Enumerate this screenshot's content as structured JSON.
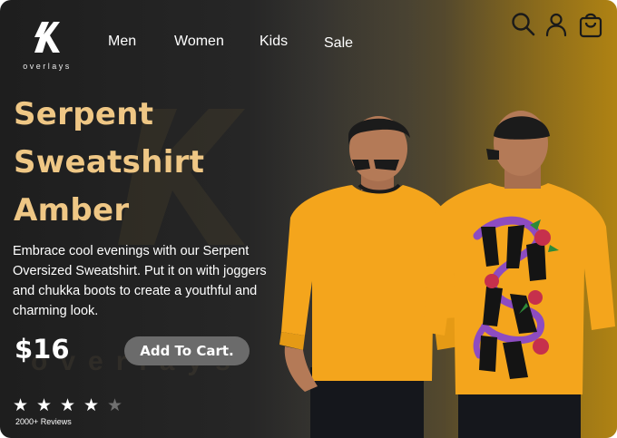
{
  "brand": {
    "name": "overlays",
    "icon": "overlays-logo-icon"
  },
  "nav": {
    "items": [
      {
        "label": "Men"
      },
      {
        "label": "Women"
      },
      {
        "label": "Kids"
      },
      {
        "label": "Sale"
      }
    ]
  },
  "header_icons": [
    "search-icon",
    "user-icon",
    "shopping-bag-icon"
  ],
  "product": {
    "title_lines": [
      "Serpent",
      "Sweatshirt",
      "Amber"
    ],
    "description": "Embrace cool evenings with our Serpent Oversized Sweatshirt. Put it on with joggers and chukka boots to create a youthful and charming look.",
    "price": "$16",
    "cart_label": "Add To Cart.",
    "rating": 4,
    "rating_max": 5,
    "reviews_label": "2000+ Reviews"
  },
  "watermark_text": "overlays",
  "colors": {
    "title": "#efc785",
    "sweatshirt": "#f4a51c",
    "button": "#6b6b6b",
    "star_filled": "#ffffff",
    "star_empty": "#6f6f6f"
  }
}
